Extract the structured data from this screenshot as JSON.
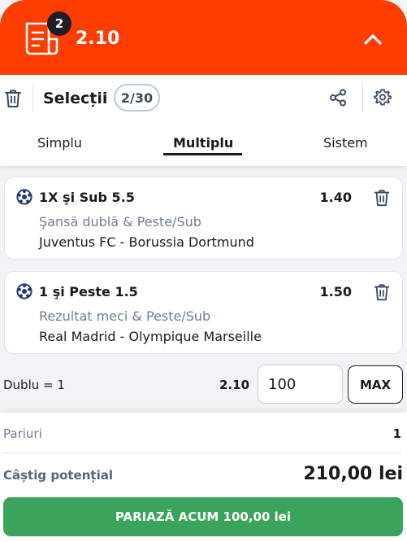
{
  "header": {
    "badge_count": "2",
    "total_odds": "2.10"
  },
  "toolbar": {
    "title": "Selecții",
    "count": "2/30"
  },
  "tabs": [
    {
      "label": "Simplu",
      "active": false
    },
    {
      "label": "Multiplu",
      "active": true
    },
    {
      "label": "Sistem",
      "active": false
    }
  ],
  "selections": [
    {
      "market": "1X şi Sub 5.5",
      "odds": "1.40",
      "market_type": "Şansă dublă & Peste/Sub",
      "match": "Juventus FC - Borussia Dortmund"
    },
    {
      "market": "1 şi Peste 1.5",
      "odds": "1.50",
      "market_type": "Rezultat meci & Peste/Sub",
      "match": "Real Madrid - Olympique Marseille"
    }
  ],
  "combo": {
    "label": "Dublu = 1",
    "odds": "2.10",
    "stake": "100",
    "max_label": "MAX"
  },
  "summary": {
    "bets_label": "Pariuri",
    "bets_value": "1",
    "win_label": "Câștig potențial",
    "win_value": "210,00 lei",
    "place_label": "PARIAZĂ ACUM 100,00 lei"
  },
  "colors": {
    "brand": "#ff3d00",
    "cta": "#3aa55a",
    "muted": "#6f7e95"
  },
  "icons": {
    "slip": "bet-slip-icon",
    "collapse": "chevron-up-icon",
    "delete": "trash-icon",
    "share": "share-icon",
    "settings": "gear-icon",
    "sport": "football-icon"
  }
}
